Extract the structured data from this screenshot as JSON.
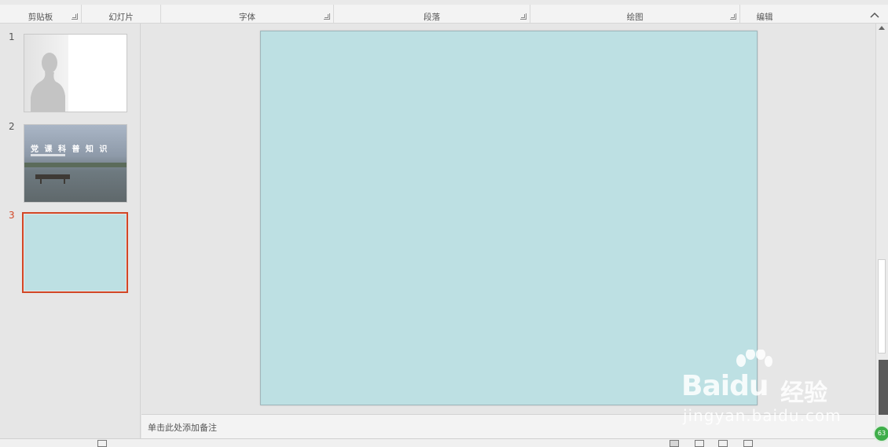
{
  "ribbon": {
    "groups": [
      {
        "label": "剪贴板",
        "launcher": true
      },
      {
        "label": "幻灯片",
        "launcher": false
      },
      {
        "label": "字体",
        "launcher": true
      },
      {
        "label": "段落",
        "launcher": true
      },
      {
        "label": "绘图",
        "launcher": true
      },
      {
        "label": "编辑",
        "launcher": false
      }
    ]
  },
  "thumbnails": [
    {
      "number": "1",
      "active": false
    },
    {
      "number": "2",
      "active": false,
      "title_text": "党 课 科 普 知 识"
    },
    {
      "number": "3",
      "active": true
    }
  ],
  "slide": {
    "background_color": "#bde0e3"
  },
  "notes": {
    "placeholder": "单击此处添加备注"
  },
  "accent_color": "#d24726",
  "watermark": {
    "brand": "Baidu",
    "brand_cn": "经验",
    "url": "jingyan.baidu.com"
  },
  "badge": {
    "text": "63"
  }
}
